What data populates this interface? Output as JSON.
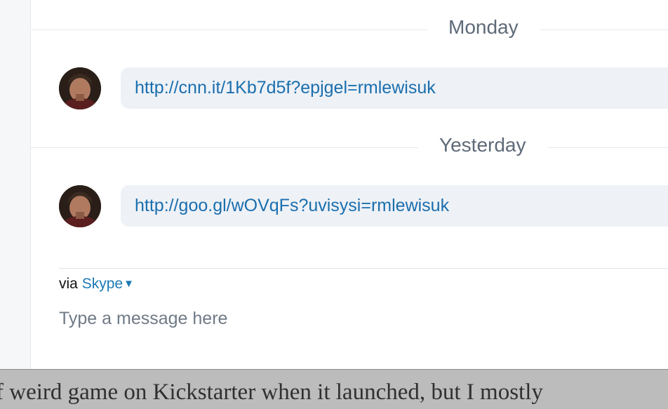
{
  "conversation": {
    "groups": [
      {
        "date_label": "Monday",
        "message_link": "http://cnn.it/1Kb7d5f?epjgel=rmlewisuk"
      },
      {
        "date_label": "Yesterday",
        "message_link": "http://goo.gl/wOVqFs?uvisysi=rmlewisuk"
      }
    ]
  },
  "composer": {
    "via_prefix": "via",
    "service_label": "Skype",
    "placeholder": "Type a message here"
  },
  "background_caption": "f weird game on Kickstarter when it launched, but I mostly",
  "colors": {
    "link": "#1a6fae",
    "bubble": "#eef1f6",
    "date_text": "#5e6a78",
    "rail": "#f6f7f9"
  }
}
